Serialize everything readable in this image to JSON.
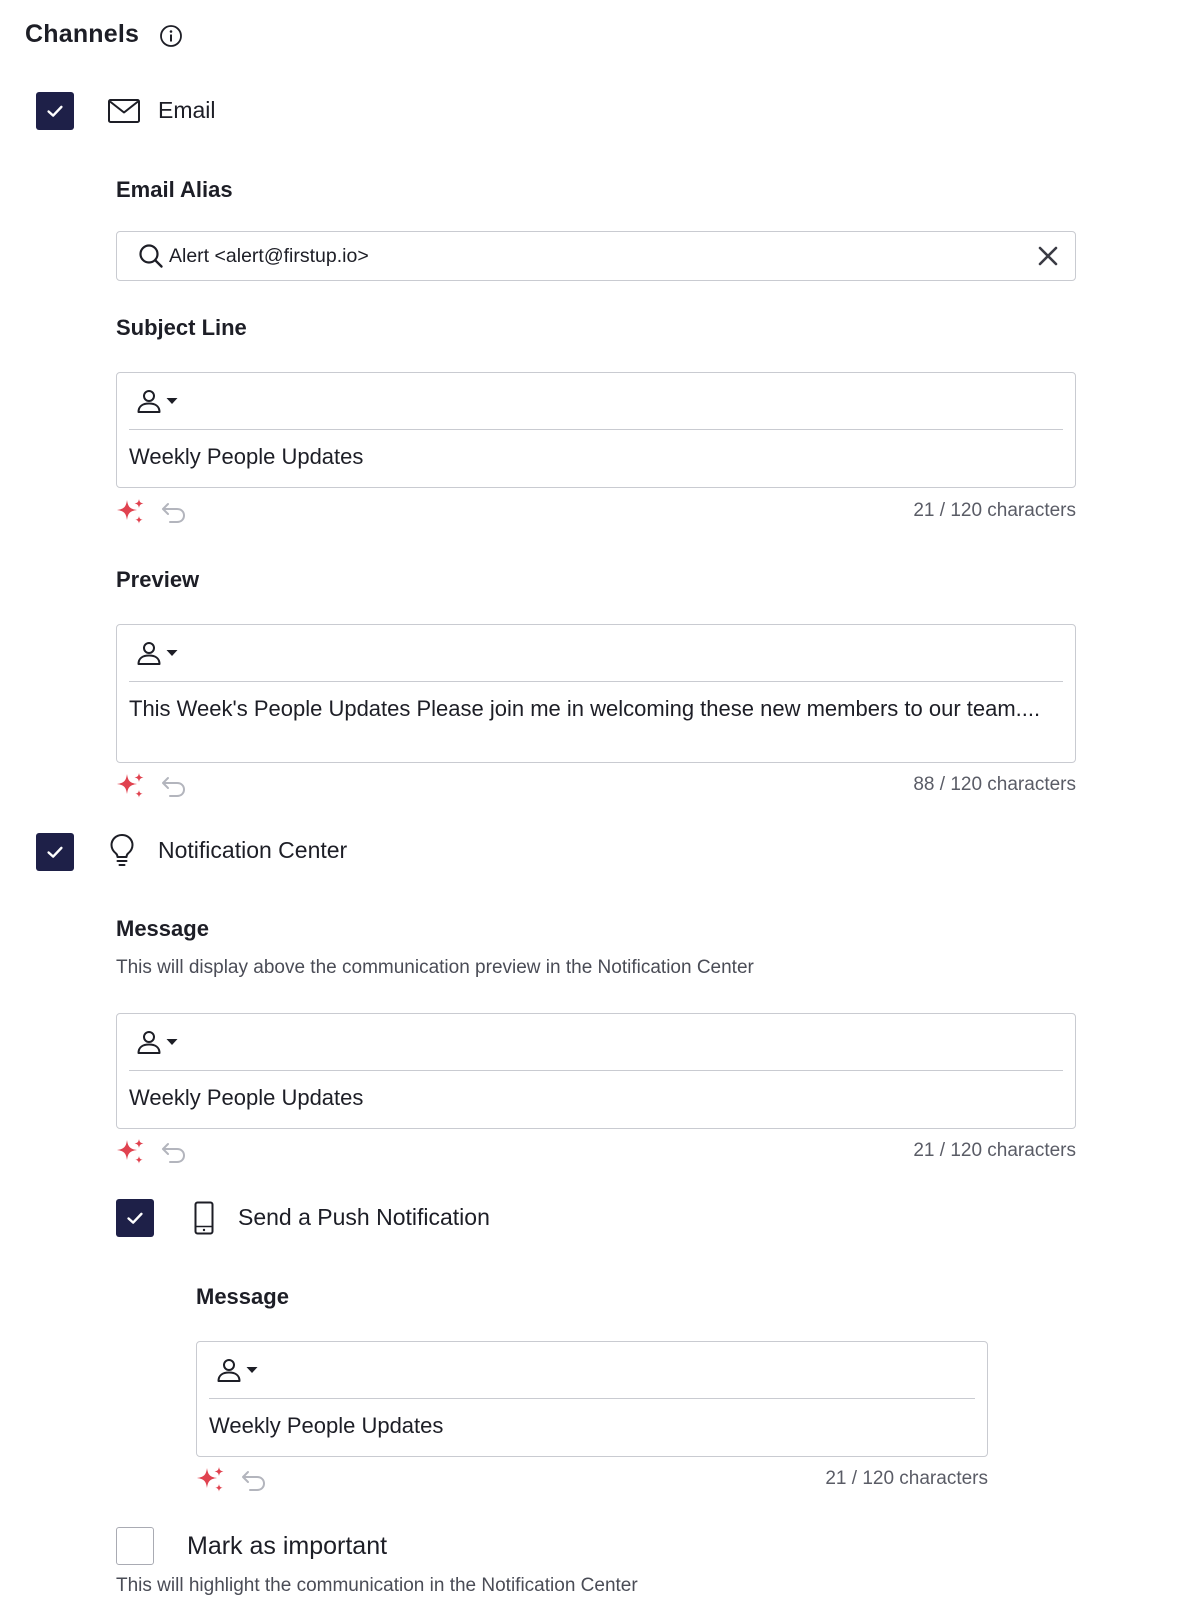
{
  "header": {
    "title": "Channels",
    "info_icon": "info-circle-icon"
  },
  "email": {
    "label": "Email",
    "checked": true,
    "alias": {
      "label": "Email Alias",
      "value": "Alert <alert@firstup.io>"
    },
    "subject": {
      "label": "Subject Line",
      "value": "Weekly People Updates",
      "counter": "21 / 120 characters"
    },
    "preview": {
      "label": "Preview",
      "value": "This Week's People Updates Please join me in welcoming these new members to our team....",
      "counter": "88 / 120 characters"
    }
  },
  "notification_center": {
    "label": "Notification Center",
    "checked": true,
    "message": {
      "label": "Message",
      "help": "This will display above the communication preview in the Notification Center",
      "value": "Weekly People Updates",
      "counter": "21 / 120 characters"
    },
    "push": {
      "label": "Send a Push Notification",
      "checked": true,
      "message": {
        "label": "Message",
        "value": "Weekly People Updates",
        "counter": "21 / 120 characters"
      }
    },
    "important": {
      "label": "Mark as important",
      "checked": false,
      "help": "This will highlight the communication in the Notification Center"
    }
  },
  "colors": {
    "checkbox": "#1e2048",
    "sparkle": "#e0424f",
    "border": "#c9cbd1"
  }
}
